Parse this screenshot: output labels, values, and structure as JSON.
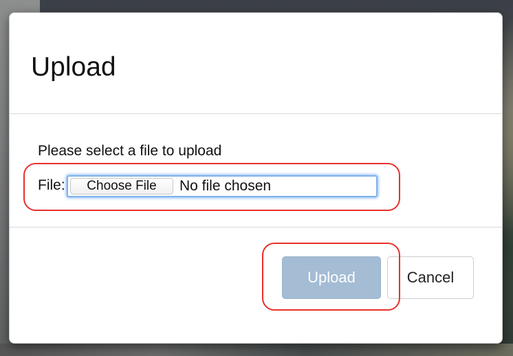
{
  "modal": {
    "title": "Upload",
    "body": {
      "prompt": "Please select a file to upload",
      "file_label": "File:",
      "choose_button": "Choose File",
      "file_status": "No file chosen"
    },
    "footer": {
      "upload_button": "Upload",
      "cancel_button": "Cancel",
      "upload_enabled": false
    }
  },
  "colors": {
    "annotation": "#e8302a",
    "upload_button_disabled": "#a4bcd4",
    "focus_ring": "#7fb3ea"
  }
}
